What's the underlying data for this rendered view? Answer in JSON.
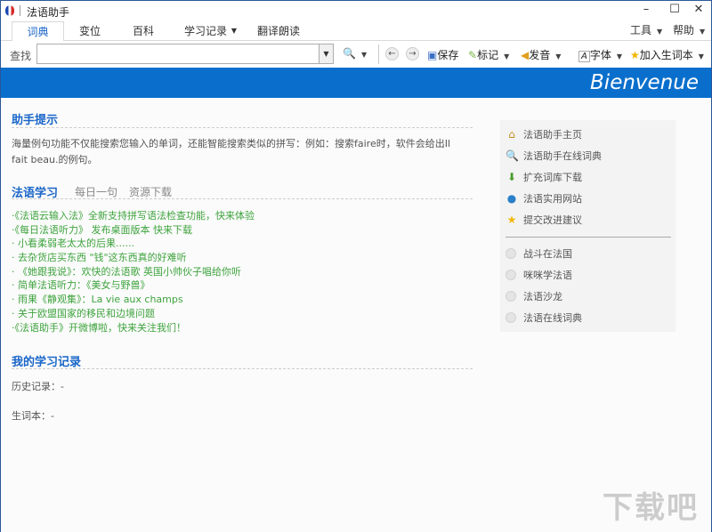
{
  "window": {
    "title": "法语助手",
    "minimize": "–",
    "maximize": "☐",
    "close": "✕"
  },
  "tabs": [
    "词典",
    "变位",
    "百科",
    "学习记录",
    "翻译朗读"
  ],
  "menus": {
    "tools": "工具",
    "help": "帮助"
  },
  "toolbar": {
    "search_label": "查找",
    "search_value": "",
    "save": "保存",
    "mark": "标记",
    "pronounce": "发音",
    "font": "字体",
    "add_vocab": "加入生词本"
  },
  "banner": "Bienvenue",
  "tips": {
    "heading": "助手提示",
    "text": "海量例句功能不仅能搜索您输入的单词，还能智能搜索类似的拼写：例如：搜索faire时，软件会给出Il fait beau.的例句。"
  },
  "learning": {
    "heading": "法语学习",
    "tabs": [
      "每日一句",
      "资源下载"
    ],
    "items": [
      "·《法语云输入法》全新支持拼写语法检查功能，快来体验",
      "·《每日法语听力》 发布桌面版本 快来下载",
      "· 小看柔弱老太太的后果......",
      "· 去杂货店买东西 \"钱\"这东西真的好难听",
      "· 《她跟我说》：欢快的法语歌 英国小帅伙子唱给你听",
      "· 简单法语听力：《美女与野兽》",
      "· 雨果《静观集》：La vie aux champs",
      "· 关于欧盟国家的移民和边境问题",
      "·《法语助手》开微博啦，快来关注我们！"
    ]
  },
  "records": {
    "heading": "我的学习记录",
    "history": "历史记录：-",
    "vocab": "生词本：-"
  },
  "sidebar": {
    "links": [
      {
        "icon": "home-icon",
        "label": "法语助手主页"
      },
      {
        "icon": "search-icon",
        "label": "法语助手在线词典"
      },
      {
        "icon": "download-icon",
        "label": "扩充词库下载"
      },
      {
        "icon": "globe-icon",
        "label": "法语实用网站"
      },
      {
        "icon": "star-icon",
        "label": "提交改进建议"
      }
    ],
    "sites": [
      "战斗在法国",
      "咪咪学法语",
      "法语沙龙",
      "法语在线词典"
    ]
  },
  "watermark": "下载吧"
}
